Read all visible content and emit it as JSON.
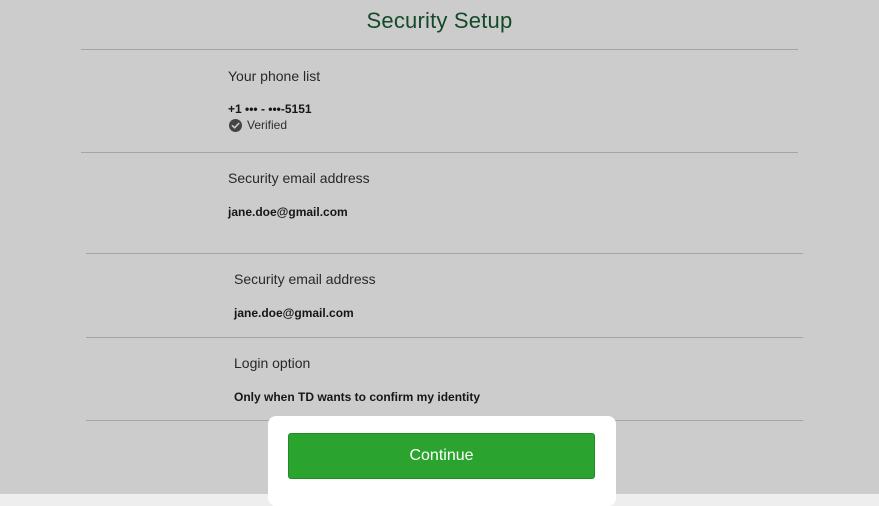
{
  "header": {
    "title": "Security Setup"
  },
  "phone_section": {
    "label": "Your phone list",
    "phone": "+1 ••• - •••-5151",
    "status": "Verified"
  },
  "email_section_1": {
    "label": "Security email address",
    "value": "jane.doe@gmail.com"
  },
  "email_section_2": {
    "label": "Security email address",
    "value": "jane.doe@gmail.com"
  },
  "login_section": {
    "label": "Login option",
    "value": "Only when TD wants to confirm my identity"
  },
  "footer": {
    "continue_label": "Continue"
  },
  "colors": {
    "accent_green": "#2aa42f",
    "title_green": "#1a5c34"
  }
}
